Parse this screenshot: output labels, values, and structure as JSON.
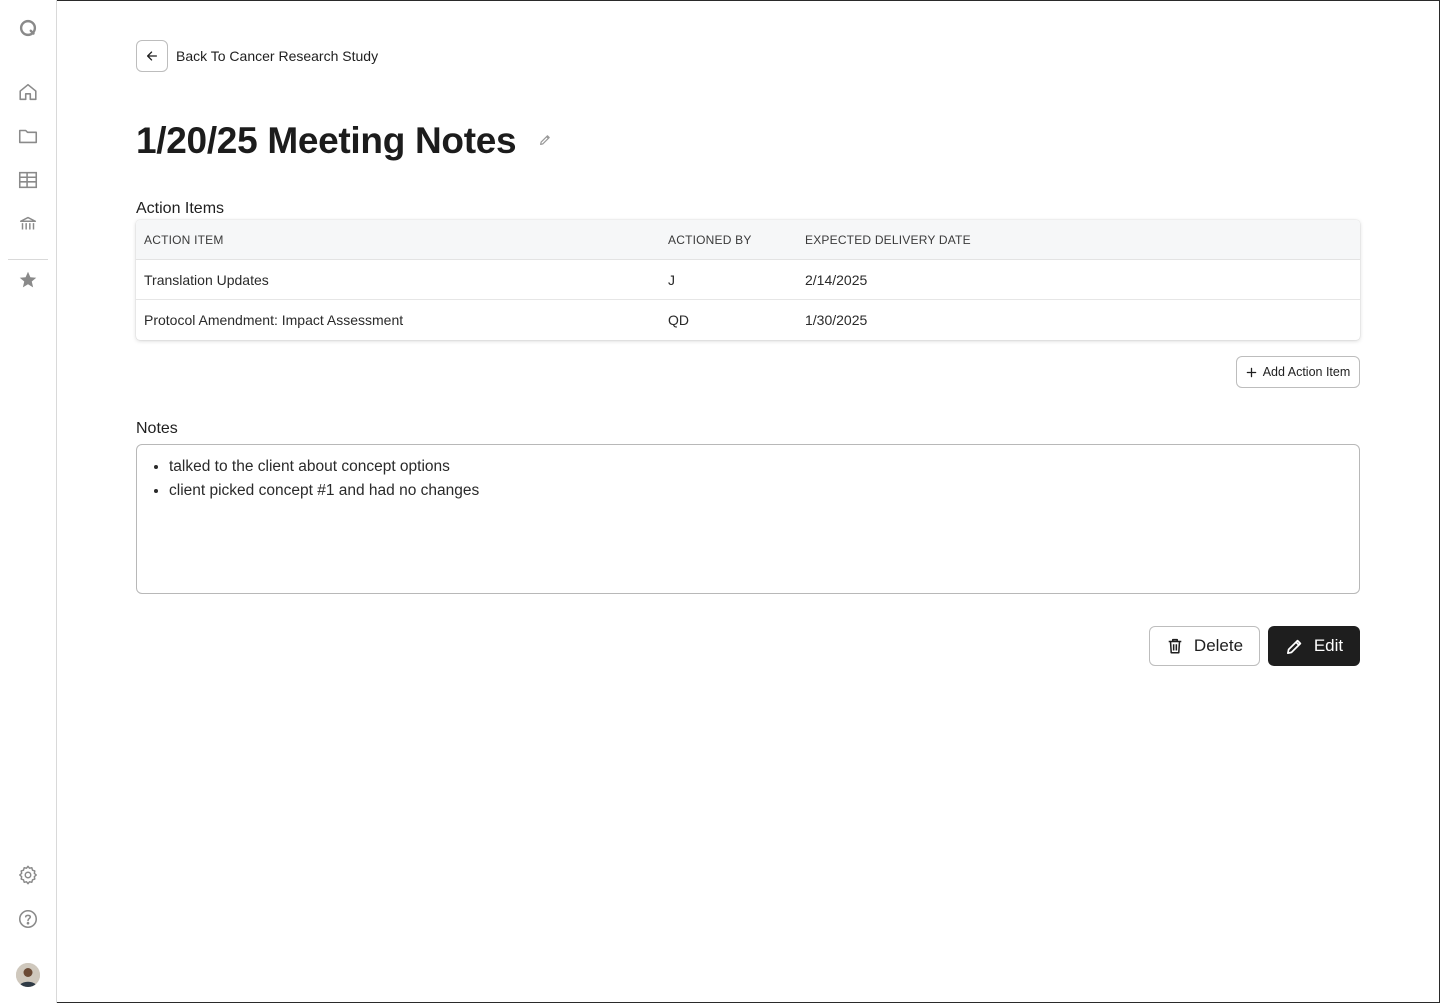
{
  "sidebar": {
    "icons": [
      "logo-icon",
      "home-icon",
      "folder-icon",
      "table-icon",
      "institution-icon",
      "star-icon",
      "gear-icon",
      "help-icon"
    ],
    "avatar": "avatar"
  },
  "header": {
    "back_label": "Back To Cancer Research Study",
    "title": "1/20/25 Meeting Notes"
  },
  "action_items": {
    "section_label": "Action Items",
    "columns": [
      "ACTION ITEM",
      "ACTIONED BY",
      "EXPECTED DELIVERY DATE"
    ],
    "rows": [
      [
        "Translation Updates",
        "J",
        "2/14/2025"
      ],
      [
        "Protocol Amendment: Impact Assessment",
        "QD",
        "1/30/2025"
      ]
    ],
    "add_label": "Add Action Item"
  },
  "notes": {
    "section_label": "Notes",
    "items": [
      "talked to the client about concept options",
      "client picked concept #1 and had no changes"
    ]
  },
  "footer": {
    "delete_label": "Delete",
    "edit_label": "Edit"
  },
  "colors": {
    "primary_button": "#1e1e1e",
    "border": "#bdbdbd",
    "icon_gray": "#8a8a8a"
  }
}
